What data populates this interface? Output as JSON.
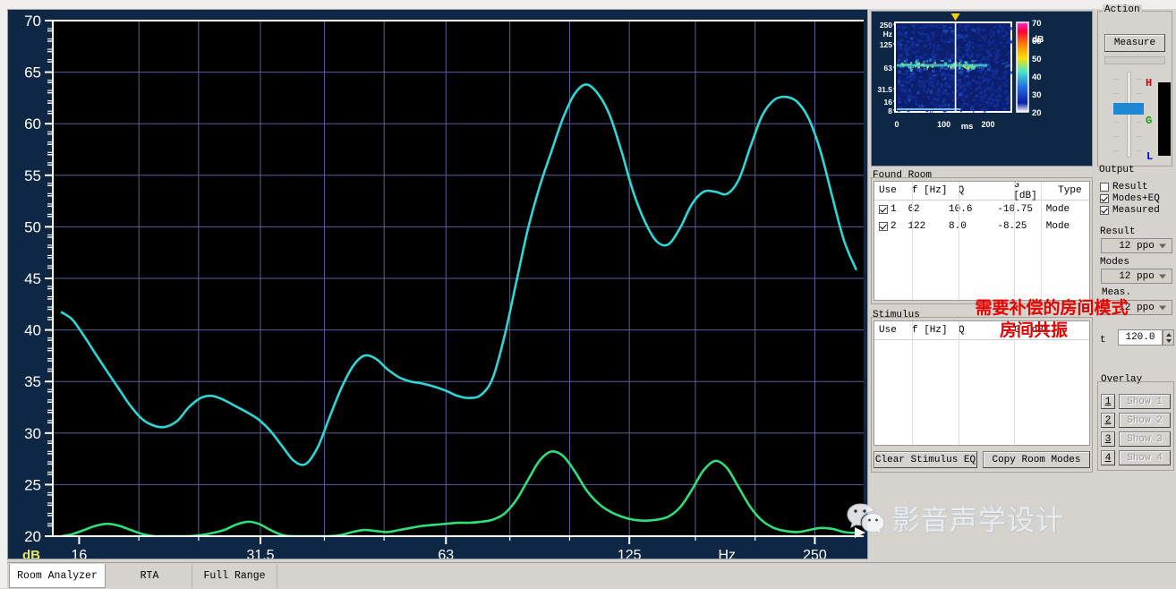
{
  "chart_data": {
    "type": "line",
    "title": "",
    "xlabel": "Hz",
    "ylabel": "dB",
    "xscale": "log",
    "xlim": [
      14.5,
      300
    ],
    "ylim": [
      20,
      70
    ],
    "xticks": [
      16,
      31.5,
      63,
      125,
      250
    ],
    "xtick_labels": [
      "16",
      "31.5",
      "63",
      "125",
      "250"
    ],
    "yticks": [
      20,
      25,
      30,
      35,
      40,
      45,
      50,
      55,
      60,
      65,
      70
    ],
    "ytick_labels": [
      "20",
      "25",
      "30",
      "35",
      "40",
      "45",
      "50",
      "55",
      "60",
      "65",
      "70"
    ],
    "grid": true,
    "background": "#000000",
    "series": [
      {
        "name": "Measured",
        "color": "#2fd6d6",
        "x": [
          15.0,
          15.6,
          16.3,
          17.0,
          17.8,
          18.6,
          19.4,
          20.3,
          21.2,
          22.1,
          23.1,
          24.1,
          25.2,
          26.3,
          27.5,
          28.7,
          30.0,
          31.3,
          32.7,
          34.2,
          35.7,
          37.3,
          39.0,
          40.7,
          42.5,
          44.4,
          46.4,
          48.5,
          50.6,
          52.9,
          55.2,
          57.7,
          60.3,
          63.0,
          65.8,
          68.7,
          71.8,
          75.0,
          78.4,
          81.9,
          85.5,
          89.3,
          93.3,
          97.5,
          101.9,
          106.4,
          111.2,
          116.2,
          121.4,
          126.8,
          132.5,
          138.4,
          144.6,
          151.1,
          157.9,
          165.0,
          172.4,
          180.1,
          188.2,
          196.6,
          205.4,
          214.6,
          224.2,
          234.2,
          244.7,
          255.7,
          267.1,
          279.0,
          291.5
        ],
        "y": [
          41.7,
          41.0,
          39.4,
          37.7,
          35.9,
          34.2,
          32.6,
          31.3,
          30.7,
          30.6,
          31.2,
          32.5,
          33.4,
          33.6,
          33.2,
          32.6,
          32.0,
          31.3,
          30.2,
          28.7,
          27.3,
          27.0,
          28.6,
          31.4,
          34.2,
          36.4,
          37.5,
          37.2,
          36.2,
          35.4,
          35.0,
          34.8,
          34.5,
          34.1,
          33.6,
          33.4,
          33.7,
          35.3,
          39.4,
          44.6,
          49.7,
          53.8,
          57.2,
          60.5,
          62.9,
          63.8,
          62.9,
          60.8,
          57.3,
          53.4,
          50.5,
          48.6,
          48.3,
          49.9,
          52.2,
          53.4,
          53.4,
          53.2,
          54.6,
          57.8,
          60.8,
          62.3,
          62.6,
          62.1,
          60.4,
          57.2,
          52.8,
          48.6,
          45.9
        ]
      },
      {
        "name": "Modes+EQ",
        "color": "#2fe07a",
        "x": [
          15.0,
          15.6,
          16.3,
          17.0,
          17.8,
          18.6,
          19.4,
          20.3,
          21.2,
          22.1,
          23.1,
          24.1,
          25.2,
          26.3,
          27.5,
          28.7,
          30.0,
          31.3,
          32.7,
          34.2,
          35.7,
          37.3,
          39.0,
          40.7,
          42.5,
          44.4,
          46.4,
          48.5,
          50.6,
          52.9,
          55.2,
          57.7,
          60.3,
          63.0,
          65.8,
          68.7,
          71.8,
          75.0,
          78.4,
          81.9,
          85.5,
          89.3,
          93.3,
          97.5,
          101.9,
          106.4,
          111.2,
          116.2,
          121.4,
          126.8,
          132.5,
          138.4,
          144.6,
          151.1,
          157.9,
          165.0,
          172.4,
          180.1,
          188.2,
          196.6,
          205.4,
          214.6,
          224.2,
          234.2,
          244.7,
          255.7,
          267.1,
          279.0,
          291.5
        ],
        "y": [
          20.0,
          20.2,
          20.6,
          21.0,
          21.2,
          21.0,
          20.6,
          20.2,
          20.0,
          20.0,
          20.0,
          20.0,
          20.1,
          20.3,
          20.6,
          21.1,
          21.4,
          21.2,
          20.6,
          20.1,
          20.0,
          20.0,
          20.0,
          20.0,
          20.1,
          20.4,
          20.6,
          20.5,
          20.4,
          20.6,
          20.8,
          21.0,
          21.1,
          21.2,
          21.3,
          21.3,
          21.4,
          21.6,
          22.2,
          23.5,
          25.4,
          27.3,
          28.2,
          27.8,
          26.3,
          24.5,
          23.2,
          22.4,
          21.9,
          21.6,
          21.5,
          21.6,
          21.9,
          22.8,
          24.5,
          26.4,
          27.3,
          26.6,
          24.7,
          22.8,
          21.5,
          20.8,
          20.5,
          20.4,
          20.6,
          20.8,
          20.7,
          20.4,
          20.3
        ]
      }
    ]
  },
  "spectrogram": {
    "ytick_labels": [
      "250",
      "Hz",
      "125",
      "63",
      "31.5",
      "16",
      "8"
    ],
    "xtick_labels": [
      "0",
      "100",
      "200"
    ],
    "xaxis_unit": "ms",
    "colorbar": {
      "unit": "dB",
      "ticks": [
        "70",
        "60",
        "50",
        "40",
        "30",
        "20"
      ],
      "max": 70,
      "min": 20
    },
    "cursor_marker": "marker-triangle"
  },
  "action": {
    "group_label": "Action",
    "measure_label": "Measure",
    "output_label": "Output",
    "meter_high": "H",
    "meter_mid": "G",
    "meter_low": "L"
  },
  "found_room": {
    "group_label": "Found Room",
    "columns": [
      "Use",
      "f [Hz]",
      "Q",
      "G [dB]",
      "Type"
    ],
    "rows": [
      {
        "checked": true,
        "index": "1",
        "f": "62",
        "q": "10.6",
        "g": "-10.75",
        "type": "Mode"
      },
      {
        "checked": true,
        "index": "2",
        "f": "122",
        "q": "8.0",
        "g": "-8.25",
        "type": "Mode"
      }
    ]
  },
  "stimulus": {
    "group_label": "Stimulus",
    "columns": [
      "Use",
      "f [Hz]",
      "Q",
      "G [dB]"
    ],
    "rows": [],
    "clear_button": "Clear Stimulus EQ",
    "copy_button": "Copy Room Modes"
  },
  "display_options": {
    "result_checkbox": {
      "label": "Result",
      "checked": false
    },
    "modes_eq_checkbox": {
      "label": "Modes+EQ",
      "checked": true
    },
    "measured_checkbox": {
      "label": "Measured",
      "checked": true
    },
    "result_label": "Result",
    "result_value": "12 ppo",
    "modes_label": "Modes",
    "modes_value": "12 ppo",
    "meas_label": "Meas.",
    "meas_value": "12 ppo",
    "t_label": "t",
    "t_value": "120.0"
  },
  "overlay": {
    "group_label": "Overlay",
    "items": [
      {
        "num": "1",
        "label": "Show 1"
      },
      {
        "num": "2",
        "label": "Show 2"
      },
      {
        "num": "3",
        "label": "Show 3"
      },
      {
        "num": "4",
        "label": "Show 4"
      }
    ]
  },
  "annotation": {
    "line1": "需要补偿的房间模式",
    "line2": "房间共振",
    "color": "#e60000"
  },
  "watermark": {
    "text": "影音声学设计",
    "icon": "wechat-icon"
  },
  "tabs": [
    {
      "label": "Room Analyzer",
      "active": true
    },
    {
      "label": "RTA",
      "active": false
    },
    {
      "label": "Full Range",
      "active": false
    }
  ]
}
